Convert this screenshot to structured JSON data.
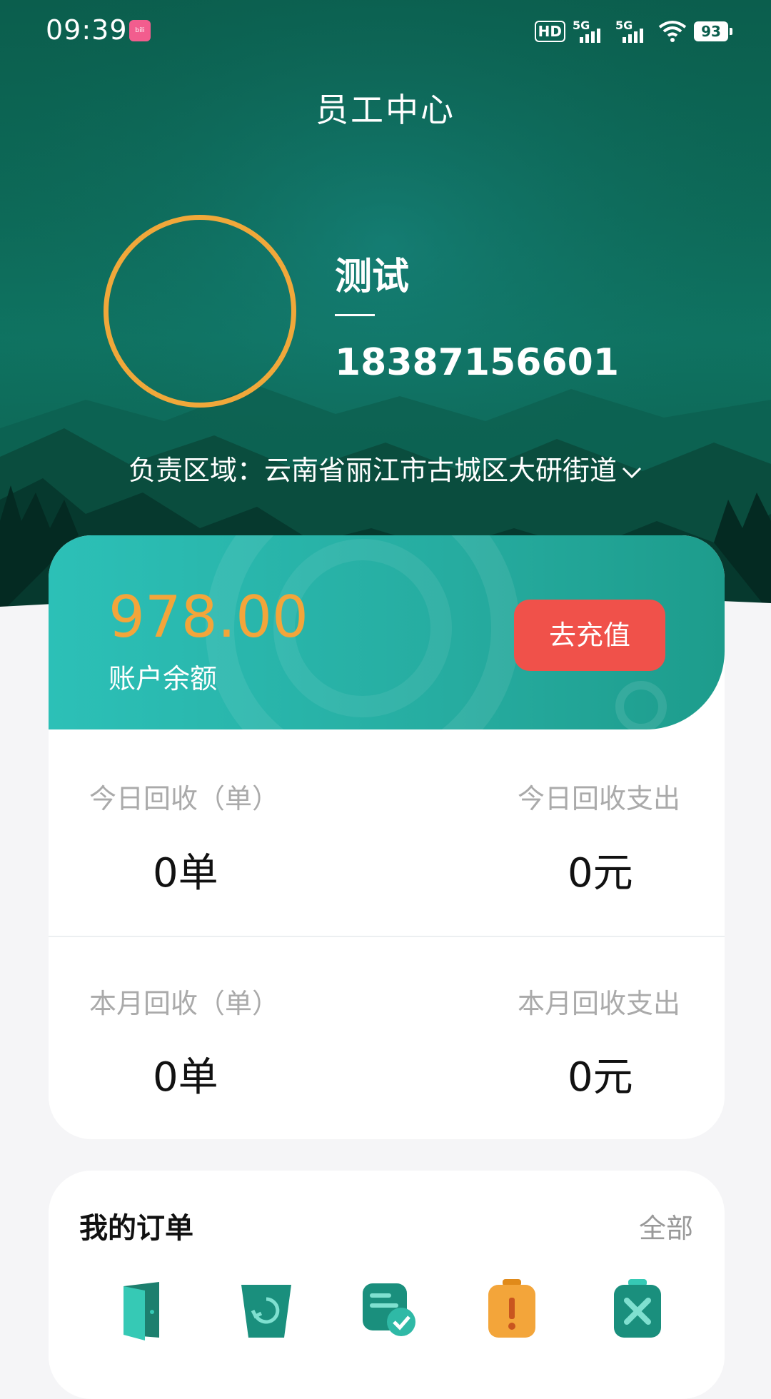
{
  "status_bar": {
    "time": "09:39",
    "app_badge": "bilibili",
    "hd_label": "HD",
    "signal_1": "5G",
    "signal_2": "5G",
    "battery": "93"
  },
  "header": {
    "title": "员工中心"
  },
  "profile": {
    "name": "测试",
    "phone": "18387156601",
    "region_label": "负责区域：",
    "region_value": "云南省丽江市古城区大研街道"
  },
  "account": {
    "balance": "978.00",
    "balance_label": "账户余额",
    "recharge_label": "去充值"
  },
  "stats": {
    "today_count_label": "今日回收（单）",
    "today_count_value": "0单",
    "today_expense_label": "今日回收支出",
    "today_expense_value": "0元",
    "month_count_label": "本月回收（单）",
    "month_count_value": "0单",
    "month_expense_label": "本月回收支出",
    "month_expense_value": "0元"
  },
  "orders": {
    "title": "我的订单",
    "all_label": "全部",
    "icons": [
      "door-icon",
      "recycle-bin-icon",
      "order-done-icon",
      "alert-icon",
      "cancel-icon"
    ]
  },
  "colors": {
    "header_green": "#0b5e4d",
    "avatar_ring": "#f0a83a",
    "balance_teal": "#2cc0b7",
    "balance_amount": "#f3a53a",
    "recharge_red": "#f0514a",
    "icon_teal": "#1a8f7d",
    "icon_orange": "#f3a53a"
  }
}
